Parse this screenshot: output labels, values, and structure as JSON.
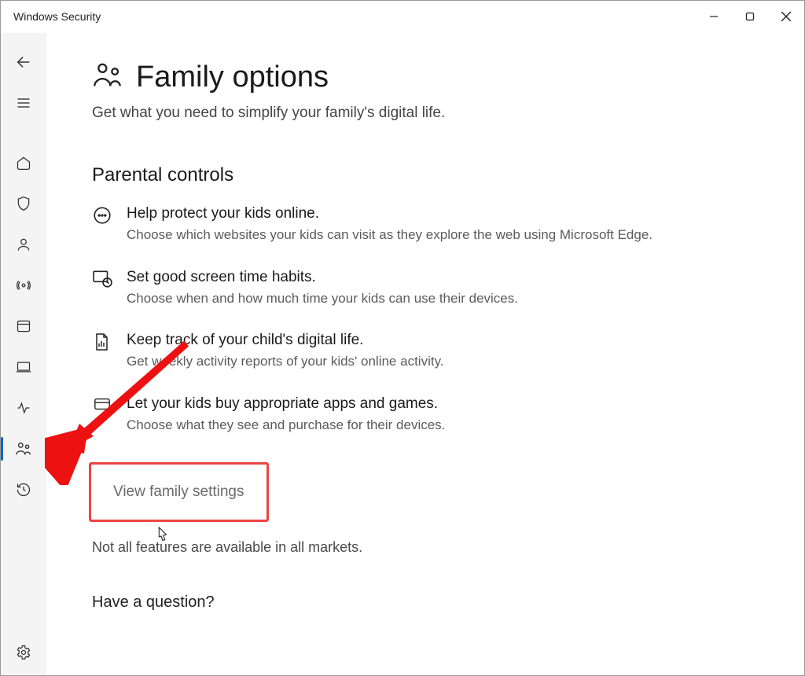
{
  "window": {
    "title": "Windows Security"
  },
  "header": {
    "title": "Family options",
    "subtitle": "Get what you need to simplify your family's digital life."
  },
  "sections": {
    "parental": {
      "heading": "Parental controls",
      "items": [
        {
          "title": "Help protect your kids online.",
          "desc": "Choose which websites your kids can visit as they explore the web using Microsoft Edge."
        },
        {
          "title": "Set good screen time habits.",
          "desc": "Choose when and how much time your kids can use their devices."
        },
        {
          "title": "Keep track of your child's digital life.",
          "desc": "Get weekly activity reports of your kids' online activity."
        },
        {
          "title": "Let your kids buy appropriate apps and games.",
          "desc": "Choose what they see and purchase for their devices."
        }
      ],
      "link": "View family settings",
      "note": "Not all features are available in all markets."
    },
    "question": {
      "heading": "Have a question?"
    }
  },
  "sidebar": {
    "items": [
      "back",
      "menu",
      "home",
      "shield",
      "account",
      "signal",
      "app",
      "device",
      "heart",
      "family",
      "history"
    ],
    "footer": "settings"
  },
  "annotation": {
    "highlight_color": "#e44"
  }
}
